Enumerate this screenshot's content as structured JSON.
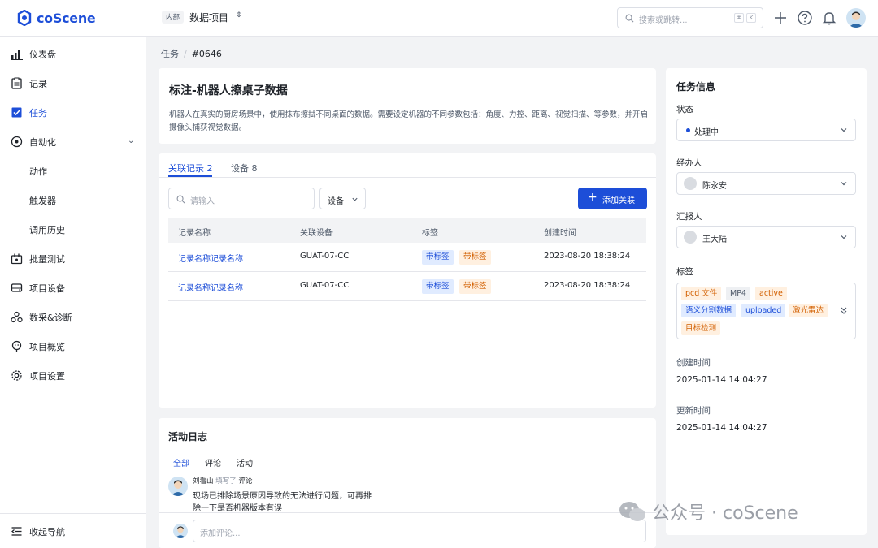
{
  "app": {
    "logo_text": "coScene",
    "project_badge": "内部",
    "project_name": "数据项目",
    "search_placeholder": "搜索或跳转...",
    "shortcut_keys": [
      "⌘",
      "K"
    ]
  },
  "sidebar": {
    "items": [
      {
        "label": "仪表盘",
        "icon": "bar-chart-icon"
      },
      {
        "label": "记录",
        "icon": "clipboard-icon"
      },
      {
        "label": "任务",
        "icon": "task-check-icon",
        "active": true
      },
      {
        "label": "自动化",
        "icon": "automation-icon",
        "expandable": true
      },
      {
        "label": "动作",
        "sub": true
      },
      {
        "label": "触发器",
        "sub": true
      },
      {
        "label": "调用历史",
        "sub": true
      },
      {
        "label": "批量测试",
        "icon": "batch-test-icon"
      },
      {
        "label": "项目设备",
        "icon": "device-icon"
      },
      {
        "label": "数采&诊断",
        "icon": "diagnosis-icon"
      },
      {
        "label": "项目概览",
        "icon": "overview-icon"
      },
      {
        "label": "项目设置",
        "icon": "settings-icon"
      }
    ],
    "collapse_label": "收起导航"
  },
  "breadcrumb": {
    "parent": "任务",
    "separator": "/",
    "current": "#0646"
  },
  "task": {
    "title": "标注-机器人擦桌子数据",
    "description": "机器人在真实的厨房场景中，使用抹布擦拭不同桌面的数据。需要设定机器的不同参数包括：角度、力控、距离、视觉扫描、等参数，并开启摄像头捕获视觉数据。"
  },
  "records": {
    "tabs": [
      "关联记录 2",
      "设备 8"
    ],
    "search_placeholder": "请输入",
    "device_filter": "设备",
    "add_button": "添加关联",
    "columns": [
      "记录名称",
      "关联设备",
      "标签",
      "创建时间"
    ],
    "rows": [
      {
        "name": "记录名称记录名称",
        "device": "GUAT-07-CC",
        "tags": [
          "带标签",
          "带标签"
        ],
        "created": "2023-08-20 18:38:24"
      },
      {
        "name": "记录名称记录名称",
        "device": "GUAT-07-CC",
        "tags": [
          "带标签",
          "带标签"
        ],
        "created": "2023-08-20 18:38:24"
      }
    ]
  },
  "activity": {
    "title": "活动日志",
    "tabs": [
      "全部",
      "评论",
      "活动"
    ],
    "entry": {
      "author": "刘看山",
      "action": "填写了",
      "type": "评论",
      "text": "现场已排除场景原因导致的无法进行问题，可再排除一下是否机器版本有误"
    },
    "comment_placeholder": "添加评论..."
  },
  "info": {
    "title": "任务信息",
    "status_label": "状态",
    "status_value": "处理中",
    "assignee_label": "经办人",
    "assignee_value": "陈永安",
    "reporter_label": "汇报人",
    "reporter_value": "王大陆",
    "tags_label": "标签",
    "tags": [
      {
        "text": "pcd 文件",
        "color": "orange"
      },
      {
        "text": "MP4",
        "color": "gray"
      },
      {
        "text": "active",
        "color": "orange"
      },
      {
        "text": "语义分割数据",
        "color": "blue"
      },
      {
        "text": "uploaded",
        "color": "blue"
      },
      {
        "text": "激光雷达",
        "color": "orange"
      },
      {
        "text": "目标检测",
        "color": "orange"
      }
    ],
    "created_label": "创建时间",
    "created_value": "2025-01-14 14:04:27",
    "updated_label": "更新时间",
    "updated_value": "2025-01-14 14:04:27"
  },
  "watermark": {
    "text": "公众号 · coScene"
  },
  "colors": {
    "accent": "#1d4ed8",
    "tag_orange": "#d25f00",
    "tag_blue_bg": "#e0ebff"
  }
}
